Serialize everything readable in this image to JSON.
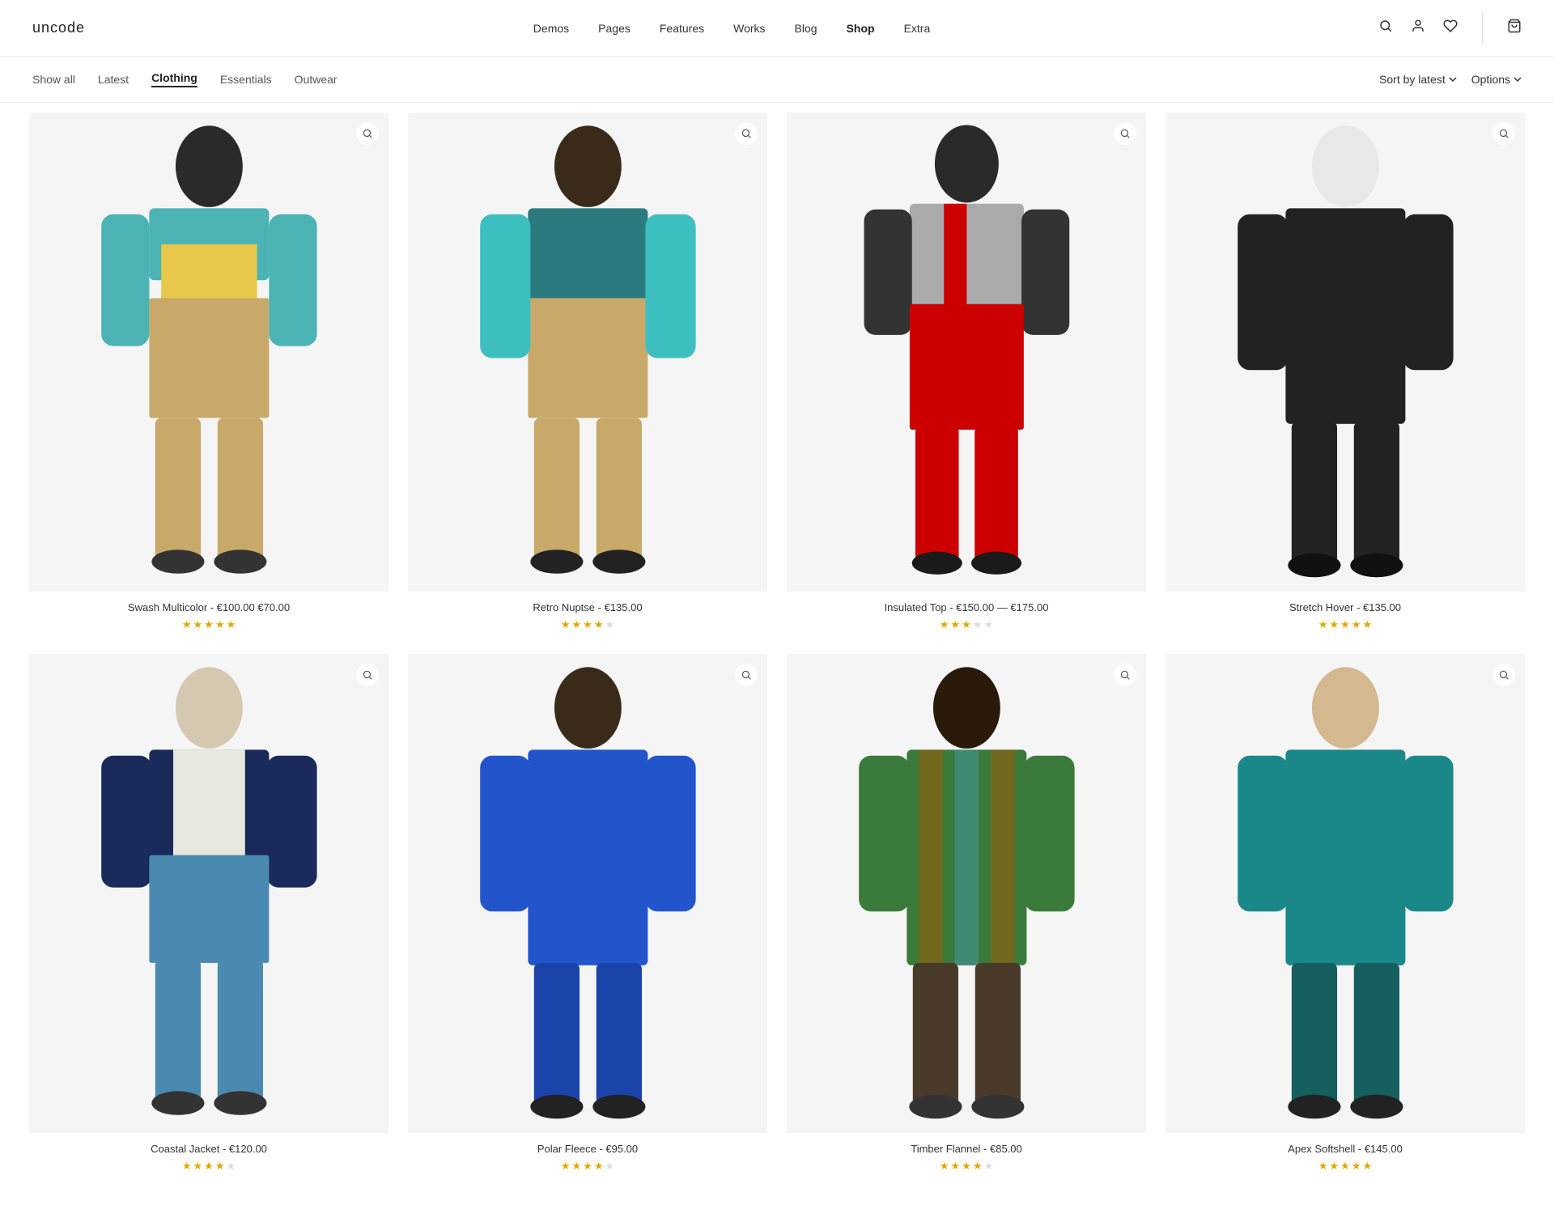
{
  "header": {
    "logo": "uncode",
    "nav_items": [
      {
        "label": "Demos",
        "active": false
      },
      {
        "label": "Pages",
        "active": false
      },
      {
        "label": "Features",
        "active": false
      },
      {
        "label": "Works",
        "active": false
      },
      {
        "label": "Blog",
        "active": false
      },
      {
        "label": "Shop",
        "active": true
      },
      {
        "label": "Extra",
        "active": false
      }
    ],
    "icons": [
      "search",
      "user",
      "heart",
      "cart"
    ]
  },
  "filter_bar": {
    "categories": [
      {
        "label": "Show all",
        "active": false
      },
      {
        "label": "Latest",
        "active": false
      },
      {
        "label": "Clothing",
        "active": true
      },
      {
        "label": "Essentials",
        "active": false
      },
      {
        "label": "Outwear",
        "active": false
      }
    ],
    "sort_label": "Sort by latest",
    "options_label": "Options"
  },
  "products": [
    {
      "name": "Swash Multicolor",
      "price_original": "€100.00",
      "price_sale": "€70.00",
      "price_display": "Swash Multicolor - €100.00 €70.00",
      "stars": 5,
      "max_stars": 5,
      "colors": [
        "#4bb3b3",
        "#e8c84a",
        "#c8a96a",
        "#1a5a7a"
      ],
      "type": "jacket_1"
    },
    {
      "name": "Retro Nuptse",
      "price_display": "Retro Nuptse - €135.00",
      "stars": 4,
      "max_stars": 5,
      "colors": [
        "#2a7a80",
        "#3dbfbf",
        "#c8a96a"
      ],
      "type": "jacket_2"
    },
    {
      "name": "Insulated Top",
      "price_display": "Insulated Top - €150.00 — €175.00",
      "stars": 3,
      "max_stars": 5,
      "colors": [
        "#cc0000",
        "#333",
        "#aaa",
        "#e8e8e8"
      ],
      "type": "jacket_3"
    },
    {
      "name": "Stretch Hover",
      "price_display": "Stretch Hover - €135.00",
      "stars": 5,
      "max_stars": 5,
      "colors": [
        "#222",
        "#111"
      ],
      "type": "jacket_4"
    },
    {
      "name": "Coastal Jacket",
      "price_display": "Coastal Jacket - €120.00",
      "stars": 4,
      "max_stars": 5,
      "colors": [
        "#1a2a5a",
        "#e8e8dc",
        "#4a8ab0"
      ],
      "type": "jacket_5"
    },
    {
      "name": "Polar Fleece",
      "price_display": "Polar Fleece - €95.00",
      "stars": 4,
      "max_stars": 5,
      "colors": [
        "#2255cc",
        "#1a44aa"
      ],
      "type": "jacket_6"
    },
    {
      "name": "Timber Flannel",
      "price_display": "Timber Flannel - €85.00",
      "stars": 4,
      "max_stars": 5,
      "colors": [
        "#3a7a3a",
        "#aa5500",
        "#4499aa"
      ],
      "type": "jacket_7"
    },
    {
      "name": "Apex Softshell",
      "price_display": "Apex Softshell - €145.00",
      "stars": 5,
      "max_stars": 5,
      "colors": [
        "#1a8888",
        "#155f5f"
      ],
      "type": "jacket_8"
    }
  ]
}
